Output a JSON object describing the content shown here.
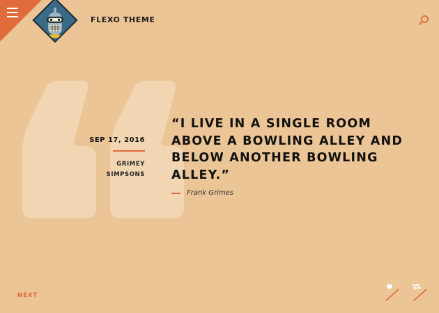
{
  "header": {
    "site_title": "FLEXO THEME",
    "menu_icon": "hamburger-icon",
    "search_icon": "search-icon",
    "accent_color": "#e06b3b"
  },
  "post": {
    "date": "SEP 17, 2016",
    "author_line1": "GRIMEY",
    "author_line2": "SIMPSONS",
    "quote": "“I LIVE IN A SINGLE ROOM ABOVE A BOWLING ALLEY AND BELOW ANOTHER BOWLING ALLEY.”",
    "cite": "Frank Grimes"
  },
  "footer": {
    "next_label": "NEXT",
    "like_icon": "heart-icon",
    "share_icon": "repeat-icon"
  },
  "colors": {
    "background": "#ecc596",
    "accent": "#e06b3b",
    "quote_mark": "#f2d6b4"
  }
}
